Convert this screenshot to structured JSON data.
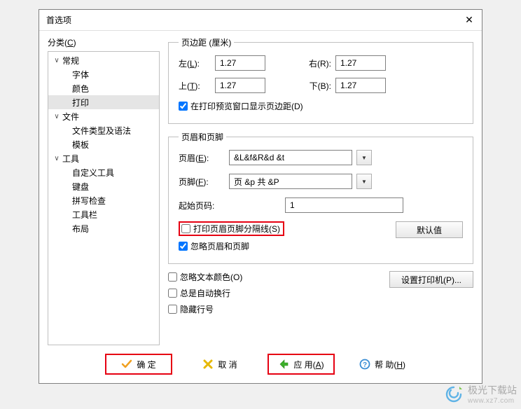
{
  "dialog": {
    "title": "首选项"
  },
  "sidebar": {
    "heading_prefix": "分类(",
    "heading_key": "C",
    "heading_suffix": ")",
    "groups": [
      {
        "label": "常规",
        "children": [
          "字体",
          "颜色",
          "打印"
        ],
        "expanded": true,
        "selected_index": 2
      },
      {
        "label": "文件",
        "children": [
          "文件类型及语法",
          "模板"
        ],
        "expanded": true
      },
      {
        "label": "工具",
        "children": [
          "自定义工具",
          "键盘",
          "拼写检查",
          "工具栏",
          "布局"
        ],
        "expanded": true
      }
    ]
  },
  "margins": {
    "legend": "页边距 (厘米)",
    "left_label": "左(",
    "left_key": "L",
    "left_suffix": "):",
    "left_value": "1.27",
    "right_label": "右(",
    "right_key": "R",
    "right_suffix": "):",
    "right_value": "1.27",
    "top_label": "上(",
    "top_key": "T",
    "top_suffix": "):",
    "top_value": "1.27",
    "bottom_label": "下(",
    "bottom_key": "B",
    "bottom_suffix": "):",
    "bottom_value": "1.27",
    "preview_check": "在打印预览窗口显示页边距(",
    "preview_key": "D",
    "preview_suffix": ")"
  },
  "headerfooter": {
    "legend": "页眉和页脚",
    "header_label": "页眉(",
    "header_key": "E",
    "header_suffix": "):",
    "header_value": "&L&f&R&d &t",
    "footer_label": "页脚(",
    "footer_key": "F",
    "footer_suffix": "):",
    "footer_value": "页 &p 共 &P",
    "start_label": "起始页码:",
    "start_value": "1",
    "sep_check": "打印页眉页脚分隔线(",
    "sep_key": "S",
    "sep_suffix": ")",
    "ignore_check": "忽略页眉和页脚",
    "default_btn": "默认值"
  },
  "options": {
    "ignore_color": "忽略文本颜色(",
    "ignore_color_key": "O",
    "ignore_color_suffix": ")",
    "wrap": "总是自动换行",
    "hide_lineno": "隐藏行号",
    "printer_btn": "设置打印机(",
    "printer_key": "P",
    "printer_suffix": ")..."
  },
  "footer": {
    "ok": "确 定",
    "cancel": "取 消",
    "apply_prefix": "应 用(",
    "apply_key": "A",
    "apply_suffix": ")",
    "help_prefix": "帮 助(",
    "help_key": "H",
    "help_suffix": ")"
  },
  "watermark": {
    "main": "极光下载站",
    "sub": "www.xz7.com"
  }
}
